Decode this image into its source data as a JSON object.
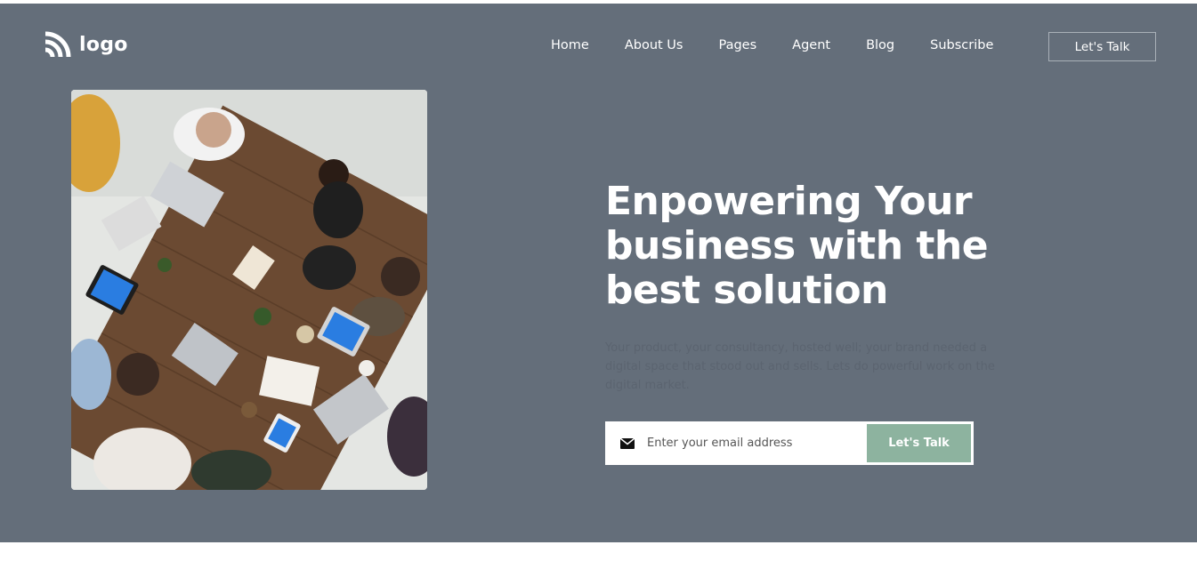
{
  "header": {
    "logo_text": "logo",
    "nav": [
      "Home",
      "About Us",
      "Pages",
      "Agent",
      "Blog",
      "Subscribe"
    ],
    "cta_label": "Let's Talk"
  },
  "hero": {
    "headline_lines": [
      "Enpowering Your",
      "business with the",
      "best solution"
    ],
    "description": "Your product, your consultancy, hosted well; your brand needed a digital space that stood out and sells. Lets do powerful work on the digital market.",
    "email_placeholder": "Enter your email address",
    "subscribe_label": "Let's Talk",
    "mail_icon": "envelope-icon"
  },
  "colors": {
    "hero_bg": "#646e7a",
    "button_green": "#8db39f",
    "text_white": "#ffffff"
  }
}
